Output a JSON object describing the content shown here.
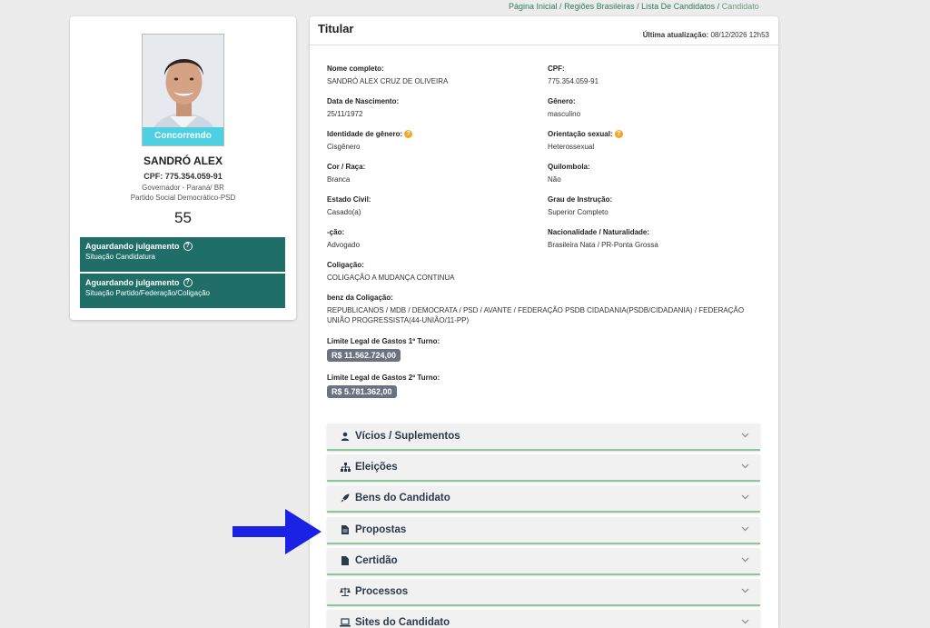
{
  "breadcrumb": {
    "home": "Página Inicial",
    "regions": "Regiões Brasileiras",
    "list": "Lista De Candidatos",
    "current": "Candidato",
    "sep": " / "
  },
  "candidate": {
    "status_badge": "Concorrendo",
    "name": "SANDRÓ ALEX",
    "cpf": "CPF: 775.354.059-91",
    "office": "Governador - Paraná/ BR",
    "party": "Partido Social Democrático-PSD",
    "number": "55",
    "status_boxes": [
      {
        "title": "Aguardando julgamento",
        "subtitle": "Situação Candidatura"
      },
      {
        "title": "Aguardando julgamento",
        "subtitle": "Situação Partido/Federação/Coligação"
      }
    ]
  },
  "panel": {
    "title": "Titular",
    "updated_label": "Última atualização:",
    "updated_value": "08/12/2026 12h53",
    "fields": {
      "nome": {
        "label": "Nome completo:",
        "value": "SANDRÓ ALEX CRUZ DE OLIVEIRA"
      },
      "cpf": {
        "label": "CPF:",
        "value": "775.354.059-91"
      },
      "nascimento": {
        "label": "Data de Nascimento:",
        "value": "25/11/1972"
      },
      "genero": {
        "label": "Gênero:",
        "value": "masculino"
      },
      "identidade": {
        "label": "Identidade de gênero:",
        "value": "Cisgênero"
      },
      "orientacao": {
        "label": "Orientação sexual:",
        "value": "Heterossexual"
      },
      "cor": {
        "label": "Cor / Raça:",
        "value": "Branca"
      },
      "quilombola": {
        "label": "Quilombola:",
        "value": "Não"
      },
      "estado_civil": {
        "label": "Estado Civil:",
        "value": "Casado(a)"
      },
      "instrucao": {
        "label": "Grau de Instrução:",
        "value": "Superior Completo"
      },
      "ocupacao": {
        "label": "-ção:",
        "value": "Advogado"
      },
      "nacionalidade": {
        "label": "Nacionalidade / Naturalidade:",
        "value": "Brasileira Nata / PR-Ponta Grossa"
      },
      "coligacao": {
        "label": "Coligação:",
        "value": "COLIGAÇÃO A MUDANÇA CONTINUA"
      },
      "composicao": {
        "label": "benz da Coligação:",
        "value": "REPUBLICANOS / MDB / DEMOCRATA / PSD / AVANTE / FEDERAÇÃO PSDB CIDADANIA(PSDB/CIDADANIA) / FEDERAÇÃO UNIÃO PROGRESSISTA(44-UNIÃO/11-PP)"
      },
      "limite1": {
        "label": "Limite Legal de Gastos 1º Turno:",
        "value": "R$ 11.562.724,00"
      },
      "limite2": {
        "label": "Limite Legal de Gastos 2º Turno:",
        "value": "R$ 5.781.362,00"
      }
    },
    "info_glyph": "?",
    "accordions": [
      {
        "label": "Vícios / Suplementos",
        "icon": "user-icon"
      },
      {
        "label": "Eleições",
        "icon": "sitemap-icon"
      },
      {
        "label": "Bens do Candidato",
        "icon": "rocket-icon"
      },
      {
        "label": "Propostas",
        "icon": "file-icon"
      },
      {
        "label": "Certidão",
        "icon": "file-icon"
      },
      {
        "label": "Processos",
        "icon": "balance-scale-icon"
      },
      {
        "label": "Sites do Candidato",
        "icon": "laptop-icon"
      }
    ]
  },
  "colors": {
    "status_green": "#1f6e68",
    "badge_cyan": "#4dd0e1",
    "accent_green": "#8bc79a",
    "arrow_blue": "#1a22e6",
    "info_orange": "#f5a623"
  }
}
